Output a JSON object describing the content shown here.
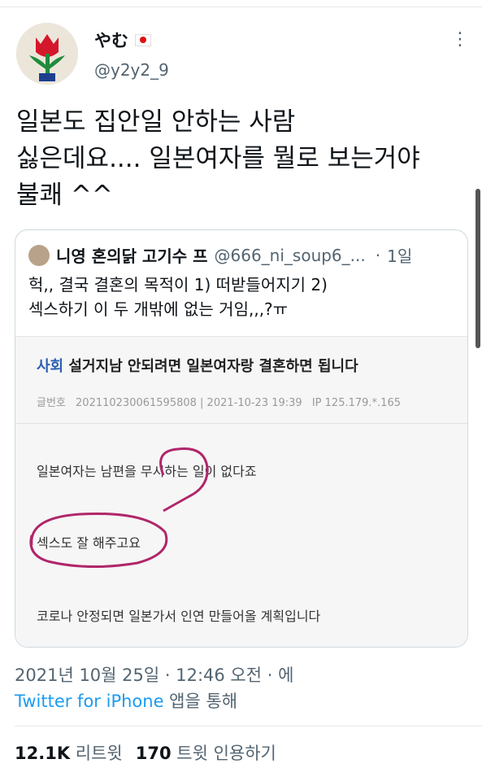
{
  "author": {
    "display_name": "やむ",
    "handle": "@y2y2_9"
  },
  "tweet": {
    "text": "일본도 집안일 안하는 사람\n싫은데요.... 일본여자를 뭘로 보는거야\n불쾌 ^^",
    "timestamp": "2021년 10월 25일 · 12:46 오전 · 에",
    "source_app": "Twitter for iPhone",
    "source_suffix": " 앱을 통해"
  },
  "quoted": {
    "name": "니영 혼의닭 고기수 프",
    "handle": "@666_ni_soup6_...",
    "time": "1일",
    "text": "헉,, 결국 결혼의 목적이 1) 떠받들어지기 2)\n섹스하기 이 두 개밖에 없는 거임,,,?ㅠ",
    "article": {
      "category": "사회",
      "headline": "설거지남 안되려면 일본여자랑 결혼하면 됩니다",
      "meta_label": "글번호",
      "meta_id": "20211023006159580​8 | 2021-10-23 19:39",
      "meta_ip": "IP 125.179.*.165",
      "line1": "일본여자는 남편을 무시하는 일이 없다죠",
      "line2": "섹스도 잘 해주고요",
      "line3": "코로나 안정되면 일본가서 인연 만들어올 계획입니다"
    }
  },
  "stats": {
    "retweets_count": "12.1K",
    "retweets_label": "리트윗",
    "quotes_count": "170",
    "quotes_label": "트윗 인용하기"
  },
  "colors": {
    "link": "#1d9bf0",
    "secondary": "#536471",
    "annotation": "#b0266a"
  }
}
